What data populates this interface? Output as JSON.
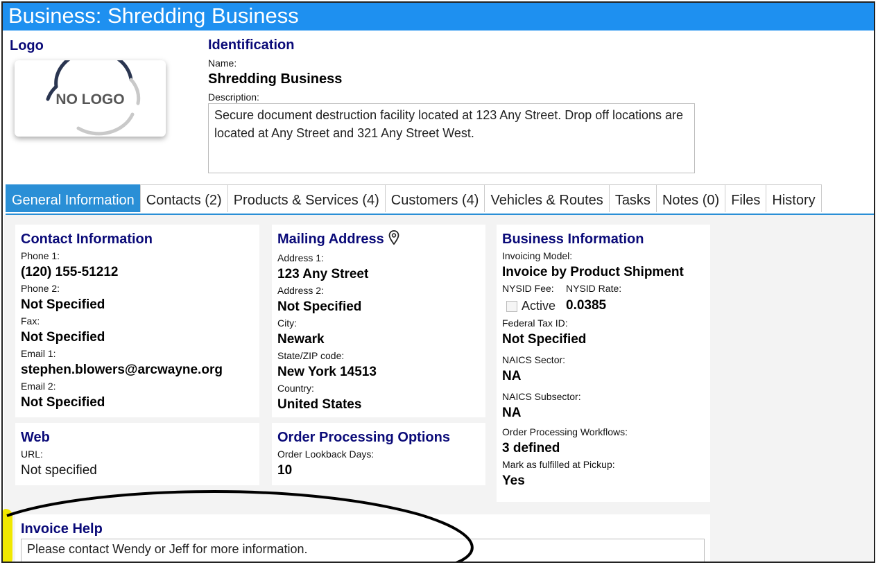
{
  "title": "Business: Shredding Business",
  "logo": {
    "heading": "Logo",
    "placeholder_text": "NO LOGO"
  },
  "identification": {
    "heading": "Identification",
    "name_label": "Name:",
    "name": "Shredding Business",
    "description_label": "Description:",
    "description": "Secure document destruction facility located at 123 Any Street. Drop off locations are located at Any Street and 321 Any Street West."
  },
  "tabs": [
    {
      "label": "General Information",
      "active": true
    },
    {
      "label": "Contacts (2)"
    },
    {
      "label": "Products & Services (4)"
    },
    {
      "label": "Customers (4)"
    },
    {
      "label": "Vehicles & Routes"
    },
    {
      "label": "Tasks"
    },
    {
      "label": "Notes (0)"
    },
    {
      "label": "Files"
    },
    {
      "label": "History"
    }
  ],
  "contact": {
    "heading": "Contact Information",
    "phone1_label": "Phone 1:",
    "phone1": "(120) 155-51212",
    "phone2_label": "Phone 2:",
    "phone2": "Not Specified",
    "fax_label": "Fax:",
    "fax": "Not Specified",
    "email1_label": "Email 1:",
    "email1": "stephen.blowers@arcwayne.org",
    "email2_label": "Email 2:",
    "email2": "Not Specified"
  },
  "mailing": {
    "heading": "Mailing Address",
    "icon": "map-pin-icon",
    "address1_label": "Address 1:",
    "address1": "123 Any Street",
    "address2_label": "Address 2:",
    "address2": "Not Specified",
    "city_label": "City:",
    "city": "Newark",
    "statezip_label": "State/ZIP code:",
    "statezip": "New York 14513",
    "country_label": "Country:",
    "country": "United States"
  },
  "business": {
    "heading": "Business Information",
    "invoicing_label": "Invoicing Model:",
    "invoicing": "Invoice by Product Shipment",
    "nysid_fee_label": "NYSID Fee:",
    "nysid_rate_label": "NYSID Rate:",
    "nysid_fee_checkbox_label": "Active",
    "nysid_rate": "0.0385",
    "taxid_label": "Federal Tax ID:",
    "taxid": "Not Specified",
    "naics_sector_label": "NAICS Sector:",
    "naics_sector": "NA",
    "naics_subsector_label": "NAICS Subsector:",
    "naics_subsector": "NA",
    "workflows_label": "Order Processing Workflows:",
    "workflows": "3 defined",
    "fulfilled_label": "Mark as fulfilled at Pickup:",
    "fulfilled": "Yes"
  },
  "web": {
    "heading": "Web",
    "url_label": "URL:",
    "url": "Not specified"
  },
  "order": {
    "heading": "Order Processing Options",
    "lookback_label": "Order Lookback Days:",
    "lookback": "10"
  },
  "invoice": {
    "heading": "Invoice Help",
    "text": "Please contact Wendy or Jeff for more information."
  },
  "colors": {
    "title_bar": "#1e90f0",
    "tab_active": "#2a8fd6",
    "heading": "#0a0a78"
  }
}
